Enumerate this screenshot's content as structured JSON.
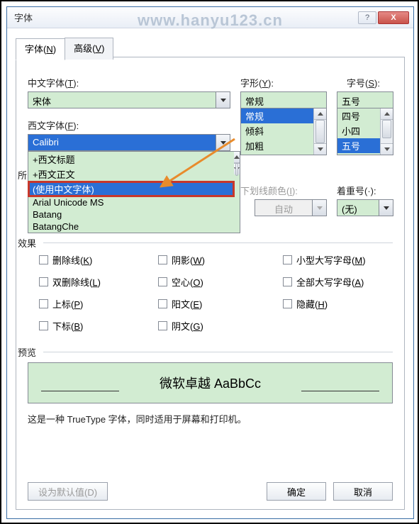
{
  "watermark": "www.hanyu123.cn",
  "title": "字体",
  "titlebar_help_tip": "?",
  "titlebar_close_tip": "X",
  "tabs": {
    "font": "字体(",
    "font_hot": "N",
    "font_end": ")",
    "adv": "高级(",
    "adv_hot": "V",
    "adv_end": ")"
  },
  "labels": {
    "cn_font": "中文字体(",
    "cn_font_hot": "T",
    "cn_font_end": "):",
    "en_font": "西文字体(",
    "en_font_hot": "F",
    "en_font_end": "):",
    "style": "字形(",
    "style_hot": "Y",
    "style_end": "):",
    "size": "字号(",
    "size_hot": "S",
    "size_end": "):",
    "all": "所",
    "ucolor": "下划线颜色(",
    "ucolor_hot": "I",
    "ucolor_end": "):",
    "emph": "着重号(·):",
    "effects": "效果",
    "preview": "预览"
  },
  "cn_font_value": "宋体",
  "en_font_value": "Calibri",
  "style_value": "常规",
  "style_options": [
    "常规",
    "倾斜",
    "加粗"
  ],
  "size_value": "五号",
  "size_options": [
    "四号",
    "小四",
    "五号"
  ],
  "ucolor_value": "自动",
  "emph_value": "(无)",
  "dropdown_items": [
    "+西文标题",
    "+西文正文",
    "(使用中文字体)",
    "Arial Unicode MS",
    "Batang",
    "BatangChe"
  ],
  "effects_col1": [
    {
      "t": "删除线(",
      "h": "K",
      "e": ")"
    },
    {
      "t": "双删除线(",
      "h": "L",
      "e": ")"
    },
    {
      "t": "上标(",
      "h": "P",
      "e": ")"
    },
    {
      "t": "下标(",
      "h": "B",
      "e": ")"
    }
  ],
  "effects_col2": [
    {
      "t": "阴影(",
      "h": "W",
      "e": ")"
    },
    {
      "t": "空心(",
      "h": "O",
      "e": ")"
    },
    {
      "t": "阳文(",
      "h": "E",
      "e": ")"
    },
    {
      "t": "阴文(",
      "h": "G",
      "e": ")"
    }
  ],
  "effects_col3": [
    {
      "t": "小型大写字母(",
      "h": "M",
      "e": ")"
    },
    {
      "t": "全部大写字母(",
      "h": "A",
      "e": ")"
    },
    {
      "t": "隐藏(",
      "h": "H",
      "e": ")"
    }
  ],
  "preview_text": "微软卓越 AaBbCc",
  "hint": "这是一种 TrueType 字体，同时适用于屏幕和打印机。",
  "buttons": {
    "default": "设为默认值(D)",
    "ok": "确定",
    "cancel": "取消"
  }
}
